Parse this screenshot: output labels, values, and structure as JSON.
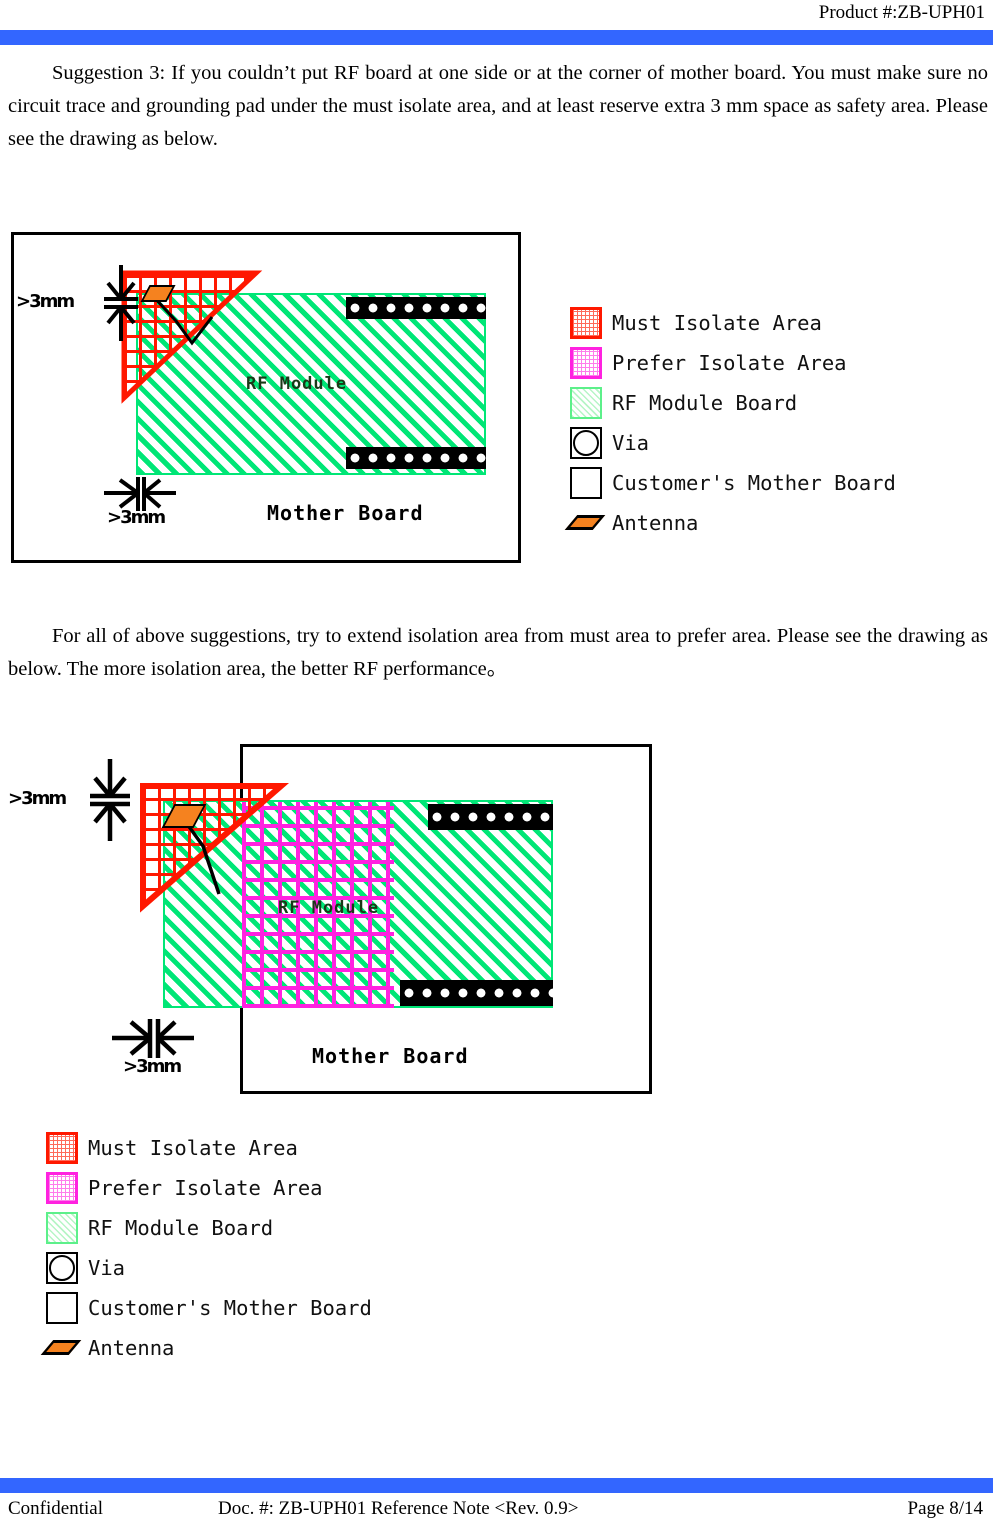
{
  "header": {
    "product_label": "Product #:ZB-UPH01"
  },
  "body": {
    "paragraph_1": "Suggestion 3: If you couldn’t put RF board at one side or at the corner of mother board. You must make sure no circuit trace and grounding pad under the must isolate area, and at least reserve extra 3 mm space as safety area. Please see the drawing as below.",
    "paragraph_2": "For all of above suggestions, try to extend isolation area from must area to prefer area. Please see the drawing as below. The more isolation area, the better RF performance。"
  },
  "figure_1": {
    "dimension_top": ">3mm",
    "dimension_bottom": ">3mm",
    "module_label": "RF Module",
    "board_label": "Mother Board"
  },
  "figure_2": {
    "dimension_top": ">3mm",
    "dimension_bottom": ">3mm",
    "module_label": "RF Module",
    "board_label": "Mother Board"
  },
  "legend": {
    "items": [
      {
        "swatch": "must-isolate-swatch",
        "label": "Must Isolate Area"
      },
      {
        "swatch": "prefer-isolate-swatch",
        "label": "Prefer Isolate Area"
      },
      {
        "swatch": "rf-module-board-swatch",
        "label": "RF Module Board"
      },
      {
        "swatch": "via-swatch",
        "label": "Via"
      },
      {
        "swatch": "mother-board-swatch",
        "label": "Customer's Mother Board"
      },
      {
        "swatch": "antenna-swatch",
        "label": "Antenna"
      }
    ]
  },
  "footer": {
    "left": "Confidential",
    "center": "Doc. #: ZB-UPH01 Reference Note <Rev. 0.9>",
    "right": "Page 8/14"
  },
  "colors": {
    "rule_blue": "#3366ff",
    "must_isolate_red": "#ff1800",
    "prefer_isolate_magenta": "#ff22e0",
    "rf_module_green": "#00e676",
    "antenna_orange": "#f5821f",
    "outline_black": "#000000"
  }
}
